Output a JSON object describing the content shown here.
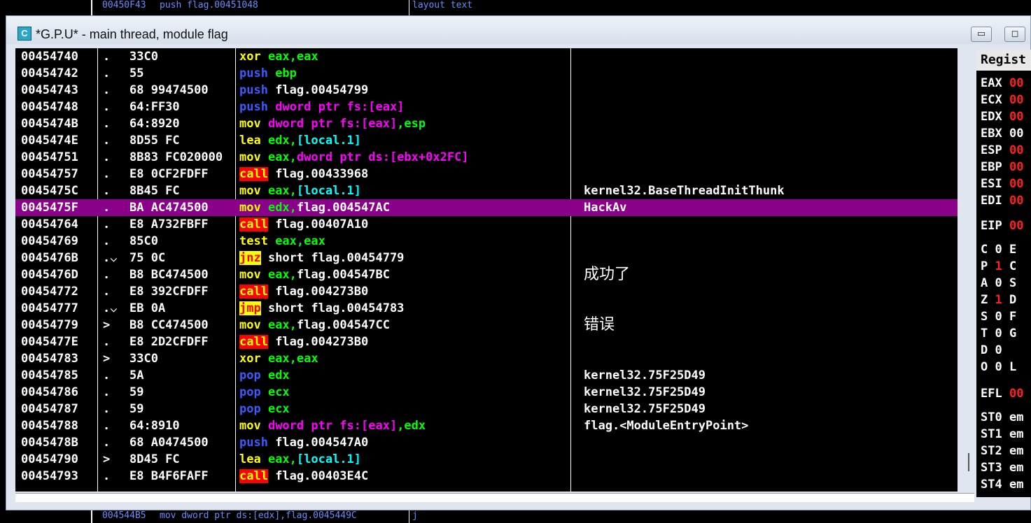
{
  "top_strip": {
    "col1": "00450F43",
    "col2": "push flag.00451048",
    "col3": "layout text"
  },
  "bottom_strip": {
    "col1": "004544B5",
    "col2": "mov dword ptr ds:[edx],flag.0045449C",
    "col3": "j"
  },
  "window": {
    "title": "*G.P.U* - main thread, module flag",
    "icon_letter": "C",
    "minimize_icon": "minimize-icon",
    "maximize_icon": "maximize-icon"
  },
  "colors": {
    "selection": "#8a008a",
    "call_bg": "#ff0000",
    "jump_bg": "#ffff00",
    "register_value": "#ff2020"
  },
  "disasm": [
    {
      "addr": "00454740",
      "mark": ".",
      "hex": "33C0",
      "ins": [
        [
          "c-y",
          "xor "
        ],
        [
          "c-g",
          "eax,eax"
        ]
      ],
      "cmt": ""
    },
    {
      "addr": "00454742",
      "mark": ".",
      "hex": "55",
      "ins": [
        [
          "c-b",
          "push "
        ],
        [
          "c-g",
          "ebp"
        ]
      ],
      "cmt": ""
    },
    {
      "addr": "00454743",
      "mark": ".",
      "hex": "68 99474500",
      "ins": [
        [
          "c-b",
          "push "
        ],
        [
          "c-w",
          "flag.00454799"
        ]
      ],
      "cmt": ""
    },
    {
      "addr": "00454748",
      "mark": ".",
      "hex": "64:FF30",
      "ins": [
        [
          "c-b",
          "push "
        ],
        [
          "c-m",
          "dword ptr fs:[eax]"
        ]
      ],
      "cmt": ""
    },
    {
      "addr": "0045474B",
      "mark": ".",
      "hex": "64:8920",
      "ins": [
        [
          "c-y",
          "mov "
        ],
        [
          "c-m",
          "dword ptr fs:[eax]"
        ],
        [
          "c-g",
          ",esp"
        ]
      ],
      "cmt": ""
    },
    {
      "addr": "0045474E",
      "mark": ".",
      "hex": "8D55 FC",
      "ins": [
        [
          "c-y",
          "lea "
        ],
        [
          "c-g",
          "edx,"
        ],
        [
          "c-c",
          "[local.1]"
        ]
      ],
      "cmt": ""
    },
    {
      "addr": "00454751",
      "mark": ".",
      "hex": "8B83 FC020000",
      "ins": [
        [
          "c-y",
          "mov "
        ],
        [
          "c-g",
          "eax,"
        ],
        [
          "c-m",
          "dword ptr ds:[ebx+0x2FC]"
        ]
      ],
      "cmt": ""
    },
    {
      "addr": "00454757",
      "mark": ".",
      "hex": "E8 0CF2FDFF",
      "ins": [
        [
          "c-call",
          "call"
        ],
        [
          "c-w",
          " flag.00433968"
        ]
      ],
      "cmt": ""
    },
    {
      "addr": "0045475C",
      "mark": ".",
      "hex": "8B45 FC",
      "ins": [
        [
          "c-y",
          "mov "
        ],
        [
          "c-g",
          "eax,"
        ],
        [
          "c-c",
          "[local.1]"
        ]
      ],
      "cmt": "kernel32.BaseThreadInitThunk"
    },
    {
      "addr": "0045475F",
      "mark": ".",
      "hex": "BA AC474500",
      "ins": [
        [
          "c-y",
          "mov "
        ],
        [
          "c-g",
          "edx,"
        ],
        [
          "c-w",
          "flag.004547AC"
        ]
      ],
      "cmt": "HackAv",
      "selected": true
    },
    {
      "addr": "00454764",
      "mark": ".",
      "hex": "E8 A732FBFF",
      "ins": [
        [
          "c-call",
          "call"
        ],
        [
          "c-w",
          " flag.00407A10"
        ]
      ],
      "cmt": ""
    },
    {
      "addr": "00454769",
      "mark": ".",
      "hex": "85C0",
      "ins": [
        [
          "c-y",
          "test "
        ],
        [
          "c-g",
          "eax,eax"
        ]
      ],
      "cmt": ""
    },
    {
      "addr": "0045476B",
      "mark": ".⌵",
      "hex": "75 0C",
      "ins": [
        [
          "c-jmp",
          "jnz"
        ],
        [
          "c-w",
          " short flag.00454779"
        ]
      ],
      "cmt": ""
    },
    {
      "addr": "0045476D",
      "mark": ".",
      "hex": "B8 BC474500",
      "ins": [
        [
          "c-y",
          "mov "
        ],
        [
          "c-g",
          "eax,"
        ],
        [
          "c-w",
          "flag.004547BC"
        ]
      ],
      "cmt": "成功了",
      "cjk": true
    },
    {
      "addr": "00454772",
      "mark": ".",
      "hex": "E8 392CFDFF",
      "ins": [
        [
          "c-call",
          "call"
        ],
        [
          "c-w",
          " flag.004273B0"
        ]
      ],
      "cmt": ""
    },
    {
      "addr": "00454777",
      "mark": ".⌵",
      "hex": "EB 0A",
      "ins": [
        [
          "c-jmp",
          "jmp"
        ],
        [
          "c-w",
          " short flag.00454783"
        ]
      ],
      "cmt": ""
    },
    {
      "addr": "00454779",
      "mark": ">",
      "hex": "B8 CC474500",
      "ins": [
        [
          "c-y",
          "mov "
        ],
        [
          "c-g",
          "eax,"
        ],
        [
          "c-w",
          "flag.004547CC"
        ]
      ],
      "cmt": "错误",
      "cjk": true
    },
    {
      "addr": "0045477E",
      "mark": ".",
      "hex": "E8 2D2CFDFF",
      "ins": [
        [
          "c-call",
          "call"
        ],
        [
          "c-w",
          " flag.004273B0"
        ]
      ],
      "cmt": ""
    },
    {
      "addr": "00454783",
      "mark": ">",
      "hex": "33C0",
      "ins": [
        [
          "c-y",
          "xor "
        ],
        [
          "c-g",
          "eax,eax"
        ]
      ],
      "cmt": ""
    },
    {
      "addr": "00454785",
      "mark": ".",
      "hex": "5A",
      "ins": [
        [
          "c-b",
          "pop "
        ],
        [
          "c-g",
          "edx"
        ]
      ],
      "cmt": "kernel32.75F25D49"
    },
    {
      "addr": "00454786",
      "mark": ".",
      "hex": "59",
      "ins": [
        [
          "c-b",
          "pop "
        ],
        [
          "c-g",
          "ecx"
        ]
      ],
      "cmt": "kernel32.75F25D49"
    },
    {
      "addr": "00454787",
      "mark": ".",
      "hex": "59",
      "ins": [
        [
          "c-b",
          "pop "
        ],
        [
          "c-g",
          "ecx"
        ]
      ],
      "cmt": "kernel32.75F25D49"
    },
    {
      "addr": "00454788",
      "mark": ".",
      "hex": "64:8910",
      "ins": [
        [
          "c-y",
          "mov "
        ],
        [
          "c-m",
          "dword ptr fs:[eax]"
        ],
        [
          "c-g",
          ",edx"
        ]
      ],
      "cmt": "flag.<ModuleEntryPoint>"
    },
    {
      "addr": "0045478B",
      "mark": ".",
      "hex": "68 A0474500",
      "ins": [
        [
          "c-b",
          "push "
        ],
        [
          "c-w",
          "flag.004547A0"
        ]
      ],
      "cmt": ""
    },
    {
      "addr": "00454790",
      "mark": ">",
      "hex": "8D45 FC",
      "ins": [
        [
          "c-y",
          "lea "
        ],
        [
          "c-g",
          "eax,"
        ],
        [
          "c-c",
          "[local.1]"
        ]
      ],
      "cmt": ""
    },
    {
      "addr": "00454793",
      "mark": ".",
      "hex": "E8 B4F6FAFF",
      "ins": [
        [
          "c-call",
          "call"
        ],
        [
          "c-w",
          " flag.00403E4C"
        ]
      ],
      "cmt": ""
    }
  ],
  "registers": {
    "header": "Regist",
    "items": [
      {
        "name": "EAX",
        "val": "00",
        "red": true
      },
      {
        "name": "ECX",
        "val": "00",
        "red": true
      },
      {
        "name": "EDX",
        "val": "00",
        "red": true
      },
      {
        "name": "EBX",
        "val": "00",
        "red": false
      },
      {
        "name": "ESP",
        "val": "00",
        "red": true
      },
      {
        "name": "EBP",
        "val": "00",
        "red": true
      },
      {
        "name": "ESI",
        "val": "00",
        "red": true
      },
      {
        "name": "EDI",
        "val": "00",
        "red": true
      },
      {
        "name": "EIP",
        "val": "00",
        "red": true
      },
      {
        "name": "C",
        "val": "0",
        "red": false,
        "extra": "E"
      },
      {
        "name": "P",
        "val": "1",
        "red": true,
        "extra": "C"
      },
      {
        "name": "A",
        "val": "0",
        "red": false,
        "extra": "S"
      },
      {
        "name": "Z",
        "val": "1",
        "red": true,
        "extra": "D"
      },
      {
        "name": "S",
        "val": "0",
        "red": false,
        "extra": "F"
      },
      {
        "name": "T",
        "val": "0",
        "red": false,
        "extra": "G"
      },
      {
        "name": "D",
        "val": "0",
        "red": false
      },
      {
        "name": "O",
        "val": "0",
        "red": false,
        "extra": "L"
      },
      {
        "name": "EFL",
        "val": "00",
        "red": true
      },
      {
        "name": "ST0",
        "val": "em",
        "red": false
      },
      {
        "name": "ST1",
        "val": "em",
        "red": false
      },
      {
        "name": "ST2",
        "val": "em",
        "red": false
      },
      {
        "name": "ST3",
        "val": "em",
        "red": false
      },
      {
        "name": "ST4",
        "val": "em",
        "red": false
      }
    ]
  }
}
